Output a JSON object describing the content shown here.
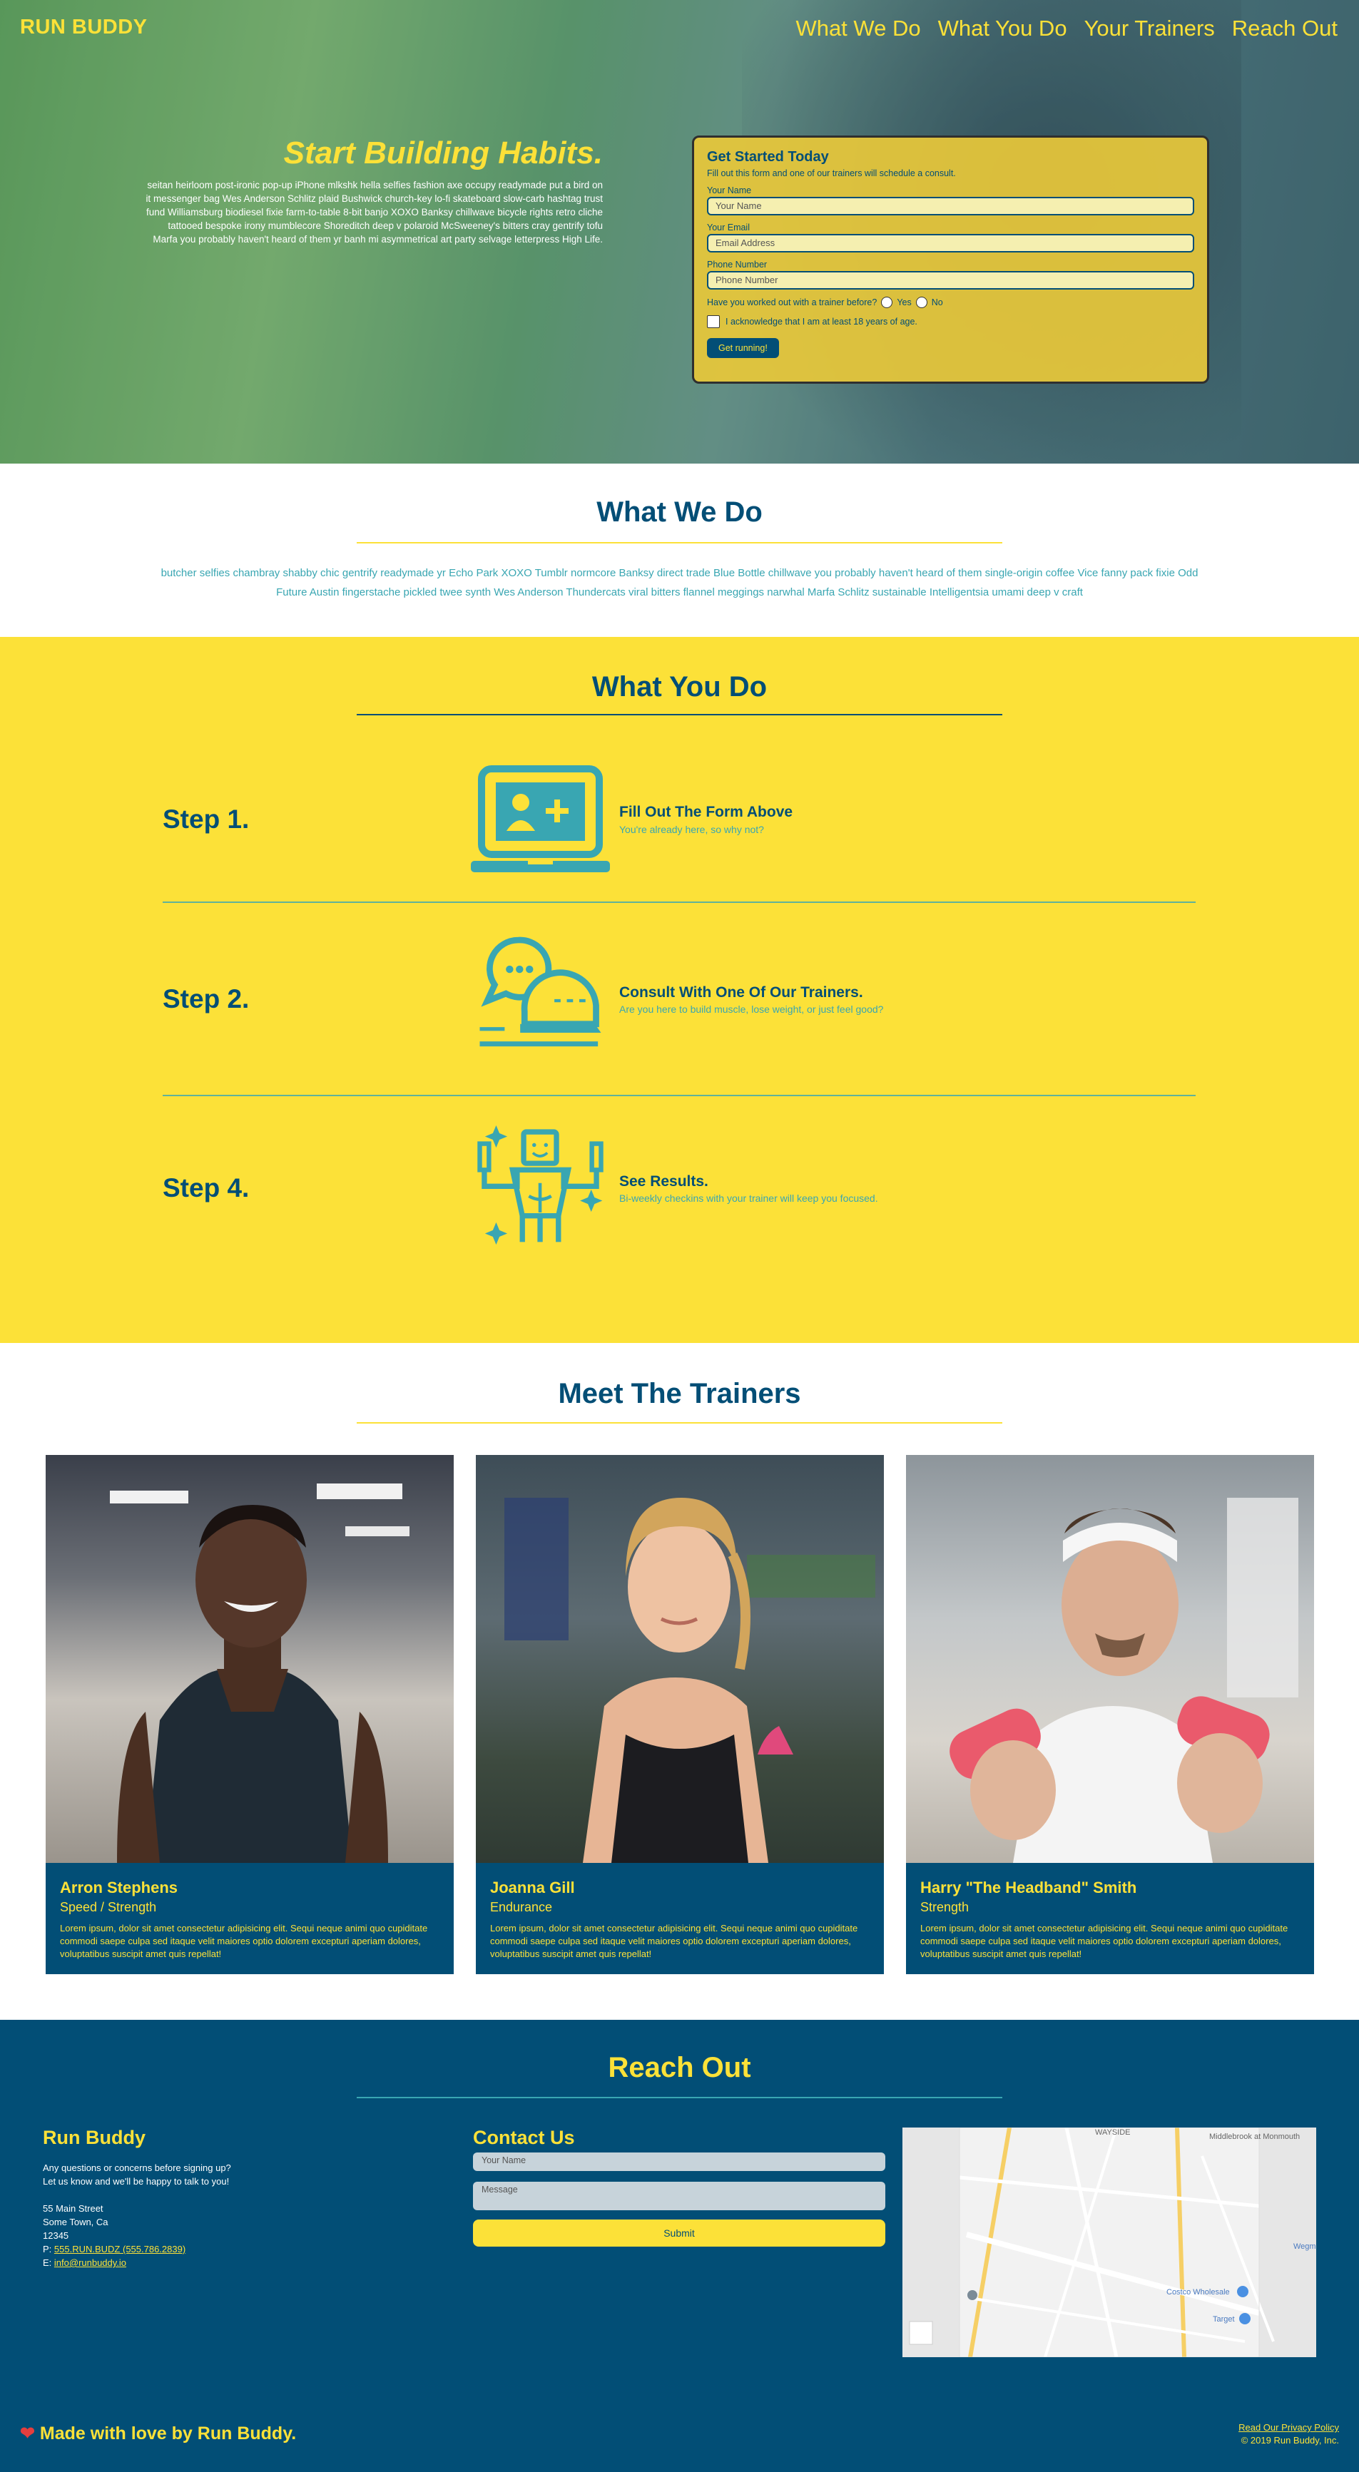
{
  "header": {
    "logo": "RUN BUDDY",
    "nav": [
      "What We Do",
      "What You Do",
      "Your Trainers",
      "Reach Out"
    ]
  },
  "hero": {
    "title": "Start Building Habits.",
    "text": "seitan heirloom post-ironic pop-up iPhone mlkshk hella selfies fashion axe occupy readymade put a bird on it messenger bag Wes Anderson Schlitz plaid Bushwick church-key lo-fi skateboard slow-carb hashtag trust fund Williamsburg biodiesel fixie farm-to-table 8-bit banjo XOXO Banksy chillwave bicycle rights retro cliche tattooed bespoke irony mumblecore Shoreditch deep v polaroid McSweeney's bitters cray gentrify tofu Marfa you probably haven't heard of them yr banh mi asymmetrical art party selvage letterpress High Life."
  },
  "signup_form": {
    "title": "Get Started Today",
    "subtitle": "Fill out this form and one of our trainers will schedule a consult.",
    "name_label": "Your Name",
    "name_placeholder": "Your Name",
    "email_label": "Your Email",
    "email_placeholder": "Email Address",
    "phone_label": "Phone Number",
    "phone_placeholder": "Phone Number",
    "question": "Have you worked out with a trainer before?",
    "yes": "Yes",
    "no": "No",
    "acknowledge": "I acknowledge that I am at least 18 years of age.",
    "button": "Get running!"
  },
  "what_we_do": {
    "title": "What We Do",
    "text": "butcher selfies chambray shabby chic gentrify readymade yr Echo Park XOXO Tumblr normcore Banksy direct trade Blue Bottle chillwave you probably haven't heard of them single-origin coffee Vice fanny pack fixie Odd Future Austin fingerstache pickled twee synth Wes Anderson Thundercats viral bitters flannel meggings narwhal Marfa Schlitz sustainable Intelligentsia umami deep v craft"
  },
  "what_you_do": {
    "title": "What You Do",
    "steps": [
      {
        "label": "Step 1.",
        "title": "Fill Out The Form Above",
        "desc": "You're already here, so why not?",
        "icon": "laptop-add-user-icon"
      },
      {
        "label": "Step 2.",
        "title": "Consult With One Of Our Trainers.",
        "desc": "Are you here to build muscle, lose weight, or just feel good?",
        "icon": "chat-bubbles-icon"
      },
      {
        "label": "Step 4.",
        "title": "See Results.",
        "desc": "Bi-weekly checkins with your trainer will keep you focused.",
        "icon": "strong-person-icon"
      }
    ]
  },
  "trainers": {
    "title": "Meet The Trainers",
    "list": [
      {
        "name": "Arron Stephens",
        "role": "Speed / Strength",
        "bio": "Lorem ipsum, dolor sit amet consectetur adipisicing elit. Sequi neque animi quo cupiditate commodi saepe culpa sed itaque velit maiores optio dolorem excepturi aperiam dolores, voluptatibus suscipit amet quis repellat!"
      },
      {
        "name": "Joanna Gill",
        "role": "Endurance",
        "bio": "Lorem ipsum, dolor sit amet consectetur adipisicing elit. Sequi neque animi quo cupiditate commodi saepe culpa sed itaque velit maiores optio dolorem excepturi aperiam dolores, voluptatibus suscipit amet quis repellat!"
      },
      {
        "name": "Harry \"The Headband\" Smith",
        "role": "Strength",
        "bio": "Lorem ipsum, dolor sit amet consectetur adipisicing elit. Sequi neque animi quo cupiditate commodi saepe culpa sed itaque velit maiores optio dolorem excepturi aperiam dolores, voluptatibus suscipit amet quis repellat!"
      }
    ]
  },
  "reach_out": {
    "title": "Reach Out",
    "company": "Run Buddy",
    "intro1": "Any questions or concerns before signing up?",
    "intro2": "Let us know and we'll be happy to talk to you!",
    "address1": "55 Main Street",
    "address2": "Some Town, Ca",
    "zip": "12345",
    "phone_prefix": "P: ",
    "phone": "555.RUN.BUDZ (555.786.2839)",
    "email_prefix": "E: ",
    "email": "info@runbuddy.io",
    "contact_title": "Contact Us",
    "name_placeholder": "Your Name",
    "message_placeholder": "Message",
    "submit": "Submit",
    "map_labels": [
      "WAYSIDE",
      "Middlebrook at Monmouth",
      "Costco Wholesale",
      "Target",
      "Wegm"
    ]
  },
  "footer": {
    "love": "Made with love by Run Buddy.",
    "privacy": "Read Our Privacy Policy",
    "copyright": "© 2019 Run Buddy, Inc."
  },
  "colors": {
    "primary": "#024e76",
    "accent": "#fce138",
    "secondary": "#39a6b2"
  }
}
